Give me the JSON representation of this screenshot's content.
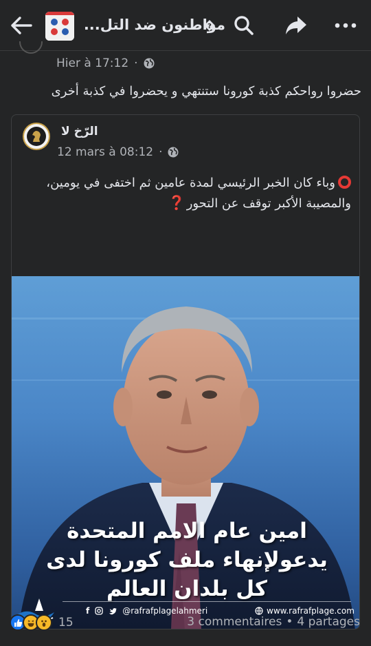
{
  "header": {
    "group_name": "مواطنون ضد التل...",
    "back_icon": "back-arrow-icon",
    "search_icon": "search-icon",
    "share_icon": "share-icon",
    "more_icon": "more-icon"
  },
  "post": {
    "timestamp": "Hier à 17:12",
    "separator": "·",
    "privacy_icon": "globe-icon",
    "text": "حضروا رواحكم كذبة كورونا ستنتهي و يحضروا في كذبة أخرى"
  },
  "shared_post": {
    "author": "الرّخ لا",
    "timestamp": "12 mars à 08:12",
    "separator": "·",
    "privacy_icon": "globe-icon",
    "line1": "وباء كان الخبر الرئيسي لمدة عامين ثم اختفى في يومين،",
    "line2": "والمصيبة الأكبر توقف عن التحور",
    "circle_icon": "red-circle-icon",
    "question_icon": "red-question-mark-icon",
    "image": {
      "caption_line1": "امين عام الامم المتحدة",
      "caption_line2": "يدعولإنهاء ملف كورونا لدى",
      "caption_line3": "كل بلدان العالم",
      "social_handle": "@rafrafplagelahmeri",
      "website": "www.rafrafplage.com"
    }
  },
  "footer": {
    "reaction_count": "15",
    "comments": "3 commentaires",
    "dot": "•",
    "shares": "4 partages"
  },
  "colors": {
    "background": "#18191a",
    "card": "#242526",
    "text_primary": "#e4e6eb",
    "text_secondary": "#b0b3b8",
    "like_blue": "#1877f2",
    "accent_red": "#e53935"
  }
}
